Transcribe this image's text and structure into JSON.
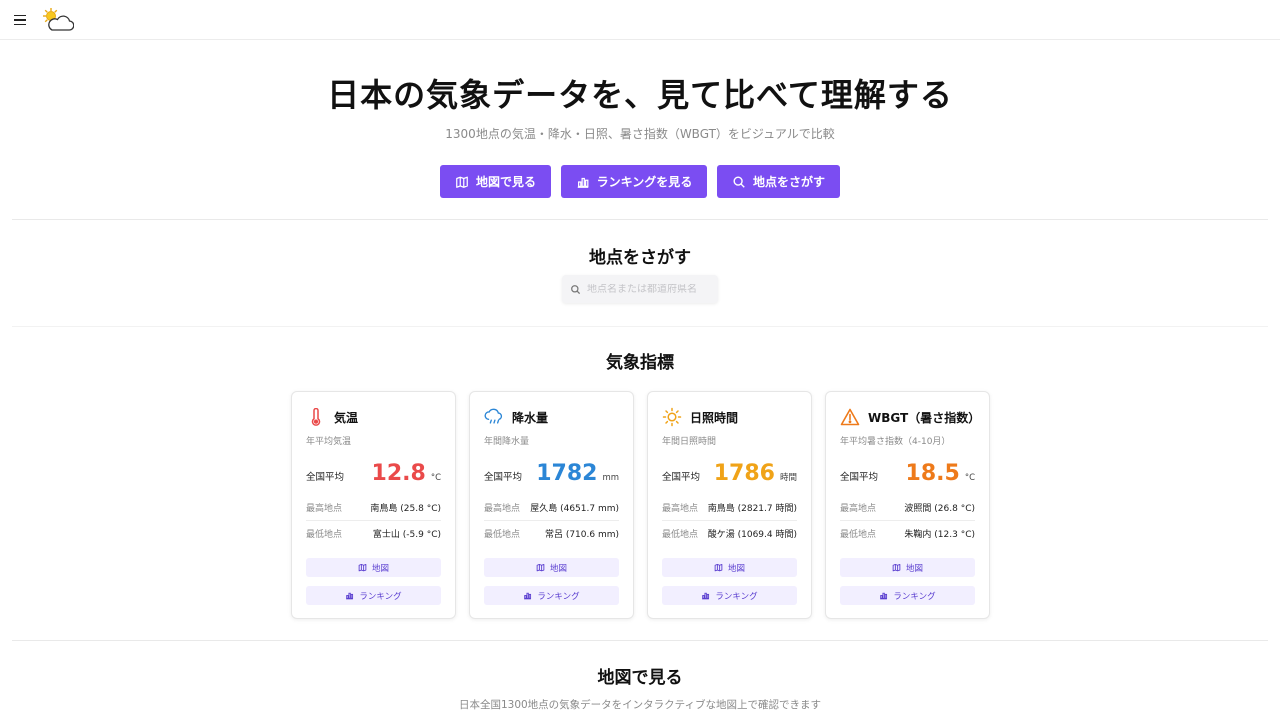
{
  "header": {
    "menu_icon": "hamburger-icon",
    "logo_icon": "sun-cloud-logo"
  },
  "hero": {
    "title": "日本の気象データを、見て比べて理解する",
    "subtitle": "1300地点の気温・降水・日照、暑さ指数（WBGT）をビジュアルで比較",
    "buttons": [
      {
        "label": "地図で見る",
        "icon": "map-icon"
      },
      {
        "label": "ランキングを見る",
        "icon": "bar-chart-icon"
      },
      {
        "label": "地点をさがす",
        "icon": "search-icon"
      }
    ]
  },
  "search_section": {
    "title": "地点をさがす",
    "placeholder": "地点名または都道府県名"
  },
  "indicators": {
    "title": "気象指標",
    "colors": {
      "temp": "#ea4a4a",
      "precip": "#2b86d6",
      "sun": "#f0a318",
      "wbgt": "#ee7a1a"
    },
    "cards": [
      {
        "key": "temp",
        "icon": "thermometer-icon",
        "title": "気温",
        "subtitle": "年平均気温",
        "avg_label": "全国平均",
        "avg_value": "12.8",
        "unit": "°C",
        "max_label": "最高地点",
        "max_value": "南鳥島 (25.8 °C)",
        "min_label": "最低地点",
        "min_value": "富士山 (-5.9 °C)",
        "map_label": "地図",
        "rank_label": "ランキング"
      },
      {
        "key": "precip",
        "icon": "rain-cloud-icon",
        "title": "降水量",
        "subtitle": "年間降水量",
        "avg_label": "全国平均",
        "avg_value": "1782",
        "unit": "mm",
        "max_label": "最高地点",
        "max_value": "屋久島 (4651.7 mm)",
        "min_label": "最低地点",
        "min_value": "常呂 (710.6 mm)",
        "map_label": "地図",
        "rank_label": "ランキング"
      },
      {
        "key": "sun",
        "icon": "sun-icon",
        "title": "日照時間",
        "subtitle": "年間日照時間",
        "avg_label": "全国平均",
        "avg_value": "1786",
        "unit": "時間",
        "max_label": "最高地点",
        "max_value": "南鳥島 (2821.7 時間)",
        "min_label": "最低地点",
        "min_value": "酸ケ湯 (1069.4 時間)",
        "map_label": "地図",
        "rank_label": "ランキング"
      },
      {
        "key": "wbgt",
        "icon": "warning-triangle-icon",
        "title": "WBGT（暑さ指数）",
        "subtitle": "年平均暑さ指数（4-10月）",
        "avg_label": "全国平均",
        "avg_value": "18.5",
        "unit": "°C",
        "max_label": "最高地点",
        "max_value": "波照間 (26.8 °C)",
        "min_label": "最低地点",
        "min_value": "朱鞠内 (12.3 °C)",
        "map_label": "地図",
        "rank_label": "ランキング"
      }
    ]
  },
  "map_section": {
    "title": "地図で見る",
    "subtitle": "日本全国1300地点の気象データをインタラクティブな地図上で確認できます"
  }
}
